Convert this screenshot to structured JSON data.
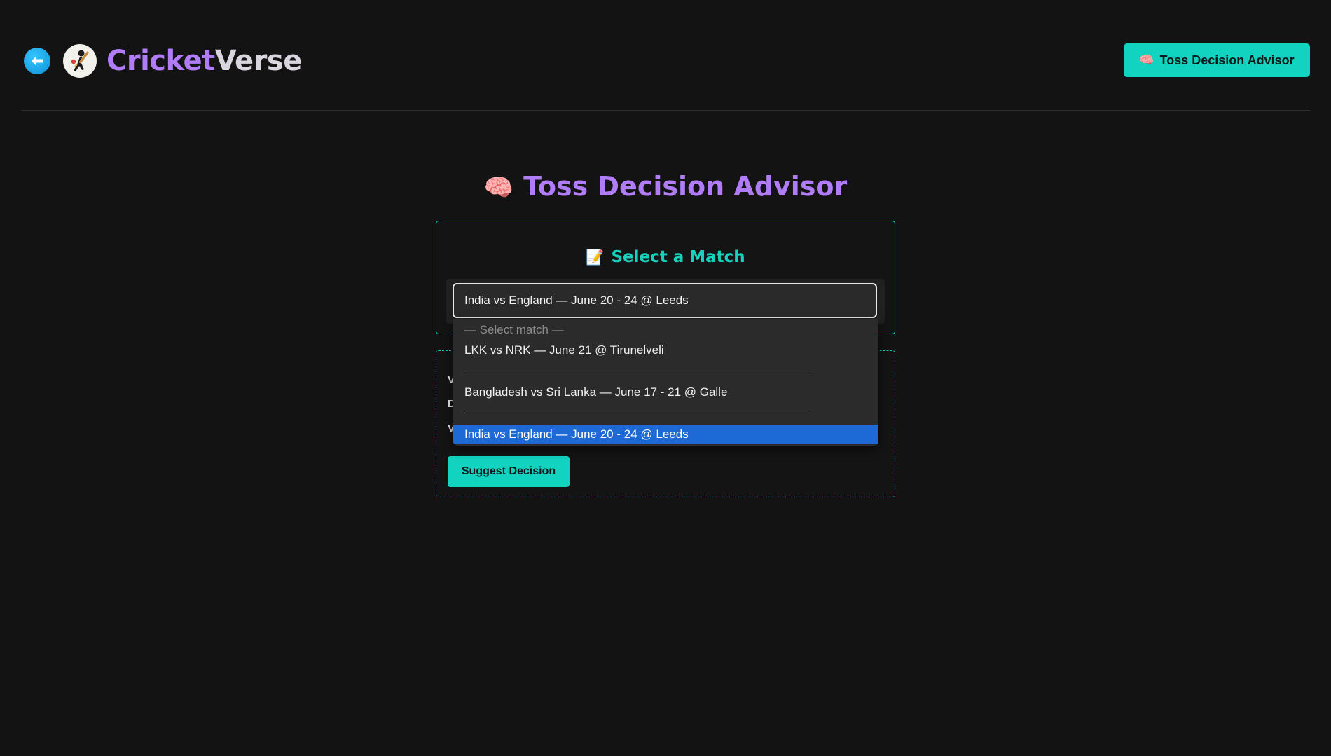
{
  "header": {
    "brand_part1": "Cricket",
    "brand_part2": "Verse",
    "nav_button_emoji": "🧠",
    "nav_button_label": "Toss Decision Advisor"
  },
  "page": {
    "title_emoji": "🧠",
    "title": "Toss Decision Advisor"
  },
  "match_card": {
    "title_emoji": "📝",
    "title": "Select a Match",
    "selected_value": "India vs England — June 20 - 24 @ Leeds"
  },
  "dropdown": {
    "placeholder": "— Select match —",
    "options": [
      "LKK vs NRK — June 21 @ Tirunelveli",
      "Bangladesh vs Sri Lanka — June 17 - 21 @ Galle",
      "India vs England — June 20 - 24 @ Leeds"
    ],
    "selected_index": 2
  },
  "info_card": {
    "line_initials": [
      "V",
      "D",
      "V"
    ],
    "suggest_button_label": "Suggest Decision"
  },
  "colors": {
    "background": "#131314",
    "accent_teal": "#12d3c0",
    "brand_purple": "#b07cf7",
    "selected_blue": "#1d69d6"
  },
  "icons": {
    "back": "arrow-left-icon",
    "logo": "cricket-batsman-icon"
  }
}
